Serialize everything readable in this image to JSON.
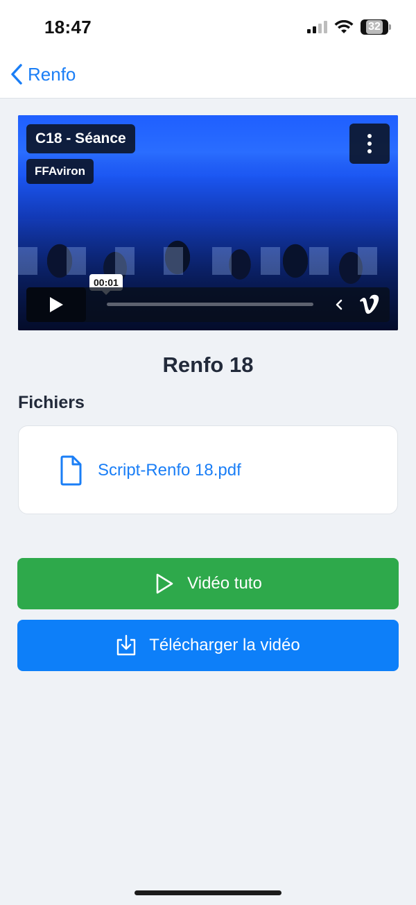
{
  "status_bar": {
    "time": "18:47",
    "battery": "32",
    "icons": [
      "signal-icon",
      "wifi-icon",
      "battery-icon"
    ]
  },
  "nav": {
    "back_label": "Renfo"
  },
  "video": {
    "title": "C18 - Séance",
    "author": "FFAviron",
    "time_tooltip": "00:01",
    "icons": [
      "more-icon",
      "play-icon",
      "collapse-icon",
      "vimeo-icon"
    ]
  },
  "session": {
    "title": "Renfo 18"
  },
  "files": {
    "heading": "Fichiers",
    "items": [
      {
        "name": "Script-Renfo 18.pdf",
        "icon": "document-icon"
      }
    ]
  },
  "actions": {
    "tuto_label": "Vidéo tuto",
    "download_label": "Télécharger la vidéo"
  },
  "colors": {
    "accent_blue": "#1a7ef6",
    "tuto_green": "#2ea94b",
    "download_blue": "#0d7ff9",
    "background": "#eff2f6"
  }
}
